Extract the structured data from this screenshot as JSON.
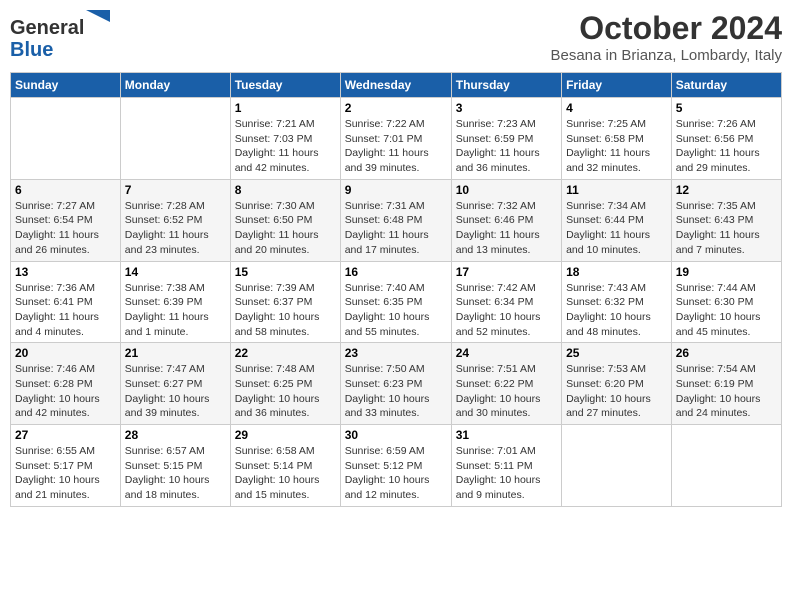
{
  "header": {
    "logo_line1": "General",
    "logo_line2": "Blue",
    "month_title": "October 2024",
    "location": "Besana in Brianza, Lombardy, Italy"
  },
  "weekdays": [
    "Sunday",
    "Monday",
    "Tuesday",
    "Wednesday",
    "Thursday",
    "Friday",
    "Saturday"
  ],
  "weeks": [
    [
      {
        "day": "",
        "sunrise": "",
        "sunset": "",
        "daylight": ""
      },
      {
        "day": "",
        "sunrise": "",
        "sunset": "",
        "daylight": ""
      },
      {
        "day": "1",
        "sunrise": "Sunrise: 7:21 AM",
        "sunset": "Sunset: 7:03 PM",
        "daylight": "Daylight: 11 hours and 42 minutes."
      },
      {
        "day": "2",
        "sunrise": "Sunrise: 7:22 AM",
        "sunset": "Sunset: 7:01 PM",
        "daylight": "Daylight: 11 hours and 39 minutes."
      },
      {
        "day": "3",
        "sunrise": "Sunrise: 7:23 AM",
        "sunset": "Sunset: 6:59 PM",
        "daylight": "Daylight: 11 hours and 36 minutes."
      },
      {
        "day": "4",
        "sunrise": "Sunrise: 7:25 AM",
        "sunset": "Sunset: 6:58 PM",
        "daylight": "Daylight: 11 hours and 32 minutes."
      },
      {
        "day": "5",
        "sunrise": "Sunrise: 7:26 AM",
        "sunset": "Sunset: 6:56 PM",
        "daylight": "Daylight: 11 hours and 29 minutes."
      }
    ],
    [
      {
        "day": "6",
        "sunrise": "Sunrise: 7:27 AM",
        "sunset": "Sunset: 6:54 PM",
        "daylight": "Daylight: 11 hours and 26 minutes."
      },
      {
        "day": "7",
        "sunrise": "Sunrise: 7:28 AM",
        "sunset": "Sunset: 6:52 PM",
        "daylight": "Daylight: 11 hours and 23 minutes."
      },
      {
        "day": "8",
        "sunrise": "Sunrise: 7:30 AM",
        "sunset": "Sunset: 6:50 PM",
        "daylight": "Daylight: 11 hours and 20 minutes."
      },
      {
        "day": "9",
        "sunrise": "Sunrise: 7:31 AM",
        "sunset": "Sunset: 6:48 PM",
        "daylight": "Daylight: 11 hours and 17 minutes."
      },
      {
        "day": "10",
        "sunrise": "Sunrise: 7:32 AM",
        "sunset": "Sunset: 6:46 PM",
        "daylight": "Daylight: 11 hours and 13 minutes."
      },
      {
        "day": "11",
        "sunrise": "Sunrise: 7:34 AM",
        "sunset": "Sunset: 6:44 PM",
        "daylight": "Daylight: 11 hours and 10 minutes."
      },
      {
        "day": "12",
        "sunrise": "Sunrise: 7:35 AM",
        "sunset": "Sunset: 6:43 PM",
        "daylight": "Daylight: 11 hours and 7 minutes."
      }
    ],
    [
      {
        "day": "13",
        "sunrise": "Sunrise: 7:36 AM",
        "sunset": "Sunset: 6:41 PM",
        "daylight": "Daylight: 11 hours and 4 minutes."
      },
      {
        "day": "14",
        "sunrise": "Sunrise: 7:38 AM",
        "sunset": "Sunset: 6:39 PM",
        "daylight": "Daylight: 11 hours and 1 minute."
      },
      {
        "day": "15",
        "sunrise": "Sunrise: 7:39 AM",
        "sunset": "Sunset: 6:37 PM",
        "daylight": "Daylight: 10 hours and 58 minutes."
      },
      {
        "day": "16",
        "sunrise": "Sunrise: 7:40 AM",
        "sunset": "Sunset: 6:35 PM",
        "daylight": "Daylight: 10 hours and 55 minutes."
      },
      {
        "day": "17",
        "sunrise": "Sunrise: 7:42 AM",
        "sunset": "Sunset: 6:34 PM",
        "daylight": "Daylight: 10 hours and 52 minutes."
      },
      {
        "day": "18",
        "sunrise": "Sunrise: 7:43 AM",
        "sunset": "Sunset: 6:32 PM",
        "daylight": "Daylight: 10 hours and 48 minutes."
      },
      {
        "day": "19",
        "sunrise": "Sunrise: 7:44 AM",
        "sunset": "Sunset: 6:30 PM",
        "daylight": "Daylight: 10 hours and 45 minutes."
      }
    ],
    [
      {
        "day": "20",
        "sunrise": "Sunrise: 7:46 AM",
        "sunset": "Sunset: 6:28 PM",
        "daylight": "Daylight: 10 hours and 42 minutes."
      },
      {
        "day": "21",
        "sunrise": "Sunrise: 7:47 AM",
        "sunset": "Sunset: 6:27 PM",
        "daylight": "Daylight: 10 hours and 39 minutes."
      },
      {
        "day": "22",
        "sunrise": "Sunrise: 7:48 AM",
        "sunset": "Sunset: 6:25 PM",
        "daylight": "Daylight: 10 hours and 36 minutes."
      },
      {
        "day": "23",
        "sunrise": "Sunrise: 7:50 AM",
        "sunset": "Sunset: 6:23 PM",
        "daylight": "Daylight: 10 hours and 33 minutes."
      },
      {
        "day": "24",
        "sunrise": "Sunrise: 7:51 AM",
        "sunset": "Sunset: 6:22 PM",
        "daylight": "Daylight: 10 hours and 30 minutes."
      },
      {
        "day": "25",
        "sunrise": "Sunrise: 7:53 AM",
        "sunset": "Sunset: 6:20 PM",
        "daylight": "Daylight: 10 hours and 27 minutes."
      },
      {
        "day": "26",
        "sunrise": "Sunrise: 7:54 AM",
        "sunset": "Sunset: 6:19 PM",
        "daylight": "Daylight: 10 hours and 24 minutes."
      }
    ],
    [
      {
        "day": "27",
        "sunrise": "Sunrise: 6:55 AM",
        "sunset": "Sunset: 5:17 PM",
        "daylight": "Daylight: 10 hours and 21 minutes."
      },
      {
        "day": "28",
        "sunrise": "Sunrise: 6:57 AM",
        "sunset": "Sunset: 5:15 PM",
        "daylight": "Daylight: 10 hours and 18 minutes."
      },
      {
        "day": "29",
        "sunrise": "Sunrise: 6:58 AM",
        "sunset": "Sunset: 5:14 PM",
        "daylight": "Daylight: 10 hours and 15 minutes."
      },
      {
        "day": "30",
        "sunrise": "Sunrise: 6:59 AM",
        "sunset": "Sunset: 5:12 PM",
        "daylight": "Daylight: 10 hours and 12 minutes."
      },
      {
        "day": "31",
        "sunrise": "Sunrise: 7:01 AM",
        "sunset": "Sunset: 5:11 PM",
        "daylight": "Daylight: 10 hours and 9 minutes."
      },
      {
        "day": "",
        "sunrise": "",
        "sunset": "",
        "daylight": ""
      },
      {
        "day": "",
        "sunrise": "",
        "sunset": "",
        "daylight": ""
      }
    ]
  ]
}
